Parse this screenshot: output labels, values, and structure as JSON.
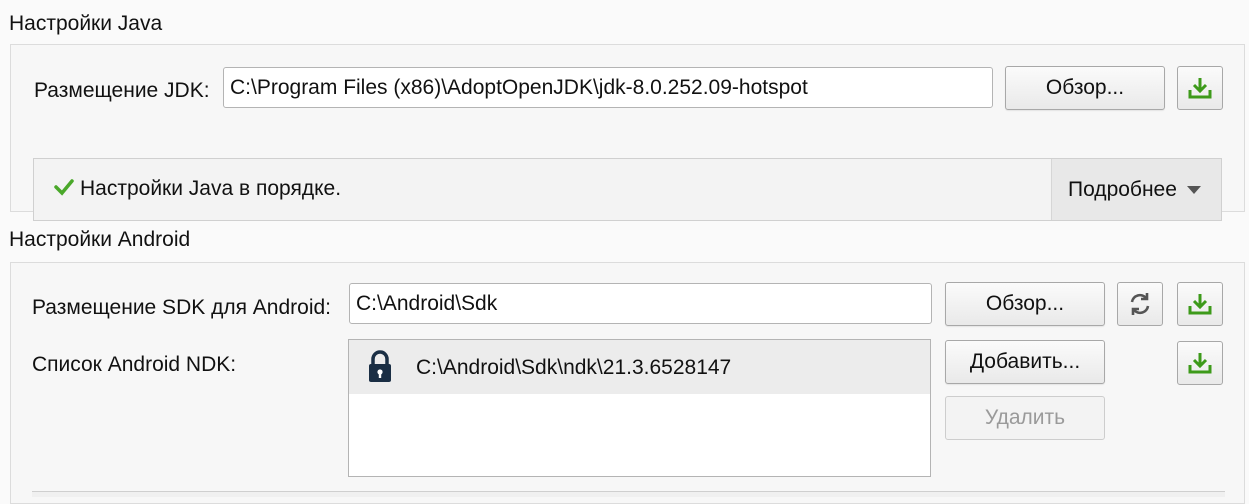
{
  "java": {
    "title": "Настройки Java",
    "jdk_label": "Размещение JDK:",
    "jdk_path": "C:\\Program Files (x86)\\AdoptOpenJDK\\jdk-8.0.252.09-hotspot",
    "browse_label": "Обзор...",
    "download_icon": "download-icon",
    "status_icon": "check-icon",
    "status_text": "Настройки Java в порядке.",
    "details_label": "Подробнее"
  },
  "android": {
    "title": "Настройки Android",
    "sdk_label": "Размещение SDK для Android:",
    "sdk_path": "C:\\Android\\Sdk",
    "browse_label": "Обзор...",
    "refresh_icon": "refresh-icon",
    "download_icon": "download-icon",
    "ndk_label": "Список Android NDK:",
    "ndk_items": [
      {
        "icon": "lock-icon",
        "path": "C:\\Android\\Sdk\\ndk\\21.3.6528147"
      }
    ],
    "add_label": "Добавить...",
    "remove_label": "Удалить"
  },
  "colors": {
    "accent_green": "#3d9a1a",
    "status_check": "#4aa82a"
  }
}
